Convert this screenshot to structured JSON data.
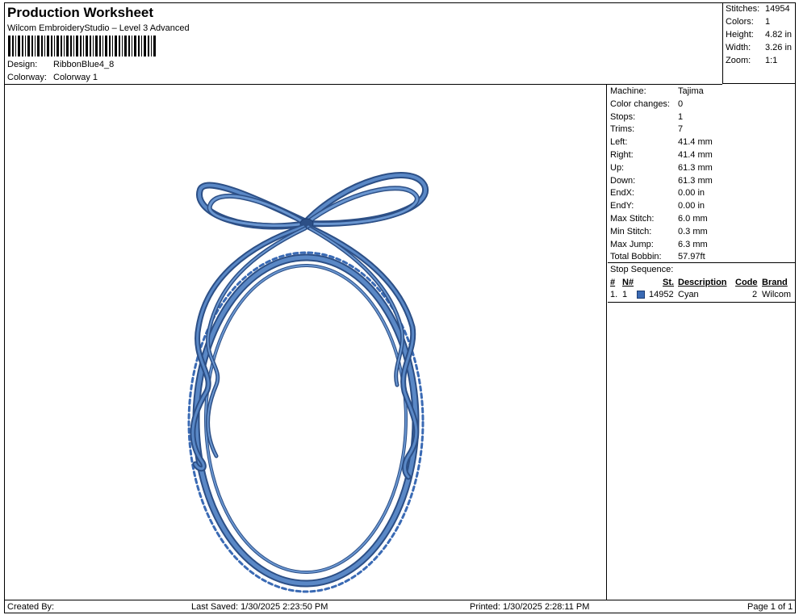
{
  "header": {
    "title": "Production Worksheet",
    "subtitle": "Wilcom EmbroideryStudio – Level 3 Advanced",
    "design_label": "Design:",
    "design_value": "RibbonBlue4_8",
    "colorway_label": "Colorway:",
    "colorway_value": "Colorway 1"
  },
  "stats": {
    "stitches_label": "Stitches:",
    "stitches_value": "14954",
    "colors_label": "Colors:",
    "colors_value": "1",
    "height_label": "Height:",
    "height_value": "4.82 in",
    "width_label": "Width:",
    "width_value": "3.26 in",
    "zoom_label": "Zoom:",
    "zoom_value": "1:1"
  },
  "properties": [
    {
      "label": "Machine:",
      "value": "Tajima"
    },
    {
      "label": "Color changes:",
      "value": "0"
    },
    {
      "label": "Stops:",
      "value": "1"
    },
    {
      "label": "Trims:",
      "value": "7"
    },
    {
      "label": "Left:",
      "value": "41.4 mm"
    },
    {
      "label": "Right:",
      "value": "41.4 mm"
    },
    {
      "label": "Up:",
      "value": "61.3 mm"
    },
    {
      "label": "Down:",
      "value": "61.3 mm"
    },
    {
      "label": "EndX:",
      "value": "0.00 in"
    },
    {
      "label": "EndY:",
      "value": "0.00 in"
    },
    {
      "label": "Max Stitch:",
      "value": "6.0 mm"
    },
    {
      "label": "Min Stitch:",
      "value": "0.3 mm"
    },
    {
      "label": "Max Jump:",
      "value": "6.3 mm"
    },
    {
      "label": "Total Bobbin:",
      "value": "57.97ft"
    }
  ],
  "stop_sequence": {
    "title": "Stop Sequence:",
    "columns": [
      "#",
      "N#",
      "St.",
      "Description",
      "Code",
      "Brand"
    ],
    "rows": [
      {
        "index": "1.",
        "needle": "1",
        "stitches": "14952",
        "description": "Cyan",
        "code": "2",
        "brand": "Wilcom",
        "color": "#3a6ab4"
      }
    ]
  },
  "footer": {
    "created_by": "Created By:",
    "last_saved": "Last Saved: 1/30/2025 2:23:50 PM",
    "printed": "Printed: 1/30/2025 2:28:11 PM",
    "page": "Page 1 of 1"
  },
  "colors": {
    "thread": "#4a78b8",
    "thread_dark": "#2c4f86"
  }
}
